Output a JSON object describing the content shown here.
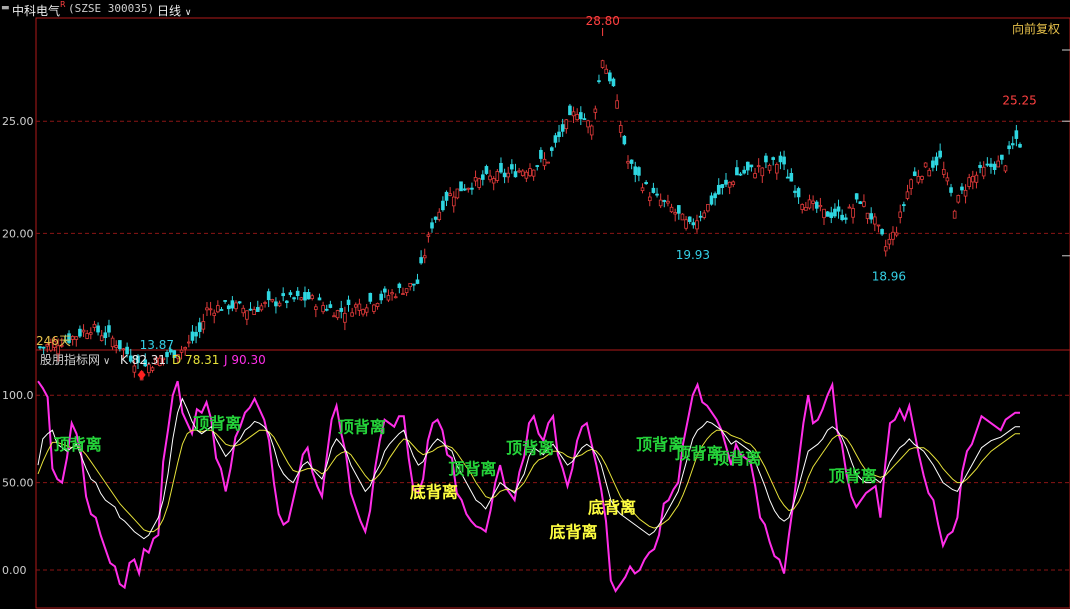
{
  "header": {
    "stock_name": "中科电气",
    "badge": "R",
    "code": "(SZSE 300035)",
    "period": "日线",
    "adjust": "向前复权"
  },
  "indicator": {
    "name": "股朋指标网",
    "k_label": "K 82.31",
    "d_label": "D 78.31",
    "j_label": "J 90.30"
  },
  "colors": {
    "background": "#000000",
    "frame": "#b01a1a",
    "grid": "#8a1515",
    "up": "#e03a3a",
    "down": "#2fd6e0",
    "k_line": "#ffffff",
    "d_line": "#e6e23a",
    "j_line": "#ff2ee8",
    "label_top": "#25d43a",
    "label_bottom": "#ffff40",
    "marker": "#ff2020"
  },
  "chart_data": [
    {
      "type": "candlestick",
      "panel": "price",
      "y_ticks": [
        "25.00",
        "20.00"
      ],
      "ylim": [
        14.8,
        29.6
      ],
      "days_label": "246天",
      "high_annotation": {
        "label": "28.80",
        "index": 155,
        "value": 28.8
      },
      "low_annotation": {
        "label": "13.87",
        "index": 28,
        "value": 13.87
      },
      "point_annotations": [
        {
          "label": "19.93",
          "index": 179,
          "value": 19.93
        },
        {
          "label": "18.96",
          "index": 233,
          "value": 18.96
        },
        {
          "label": "25.25",
          "index": 269,
          "value": 25.25
        }
      ],
      "close_anchors": [
        [
          0,
          14.9
        ],
        [
          8,
          15.3
        ],
        [
          14,
          15.8
        ],
        [
          20,
          15.3
        ],
        [
          28,
          14.0
        ],
        [
          32,
          14.3
        ],
        [
          40,
          14.9
        ],
        [
          44,
          15.6
        ],
        [
          46,
          16.6
        ],
        [
          52,
          16.8
        ],
        [
          58,
          16.6
        ],
        [
          66,
          17.0
        ],
        [
          74,
          17.1
        ],
        [
          82,
          16.5
        ],
        [
          90,
          16.9
        ],
        [
          97,
          17.3
        ],
        [
          104,
          17.8
        ],
        [
          108,
          20.4
        ],
        [
          112,
          21.6
        ],
        [
          116,
          22.0
        ],
        [
          122,
          22.4
        ],
        [
          128,
          22.6
        ],
        [
          134,
          22.9
        ],
        [
          140,
          23.3
        ],
        [
          144,
          24.6
        ],
        [
          148,
          25.5
        ],
        [
          152,
          24.7
        ],
        [
          155,
          27.8
        ],
        [
          158,
          26.5
        ],
        [
          162,
          23.2
        ],
        [
          168,
          21.8
        ],
        [
          174,
          21.1
        ],
        [
          179,
          20.3
        ],
        [
          186,
          21.6
        ],
        [
          192,
          22.6
        ],
        [
          198,
          22.9
        ],
        [
          204,
          23.2
        ],
        [
          210,
          21.5
        ],
        [
          216,
          20.9
        ],
        [
          222,
          20.8
        ],
        [
          226,
          21.5
        ],
        [
          230,
          20.5
        ],
        [
          233,
          19.4
        ],
        [
          236,
          20.2
        ],
        [
          240,
          22.4
        ],
        [
          244,
          22.9
        ],
        [
          248,
          23.3
        ],
        [
          252,
          21.2
        ],
        [
          256,
          22.4
        ],
        [
          262,
          23.0
        ],
        [
          266,
          23.2
        ],
        [
          269,
          24.2
        ],
        [
          270,
          24.0
        ]
      ]
    },
    {
      "type": "line",
      "panel": "KDJ",
      "y_ticks": [
        "100.0",
        "50.00",
        "0.00"
      ],
      "ylim": [
        -20,
        115
      ],
      "series": [
        {
          "name": "K",
          "values": [
            60,
            75,
            78,
            80,
            72,
            70,
            68,
            70,
            72,
            65,
            58,
            52,
            50,
            44,
            40,
            38,
            36,
            30,
            28,
            25,
            22,
            20,
            18,
            20,
            25,
            30,
            40,
            55,
            75,
            90,
            98,
            92,
            85,
            80,
            78,
            80,
            82,
            75,
            70,
            65,
            68,
            72,
            75,
            80,
            82,
            85,
            84,
            82,
            78,
            70,
            60,
            55,
            52,
            50,
            55,
            60,
            62,
            58,
            55,
            52,
            60,
            70,
            75,
            72,
            68,
            60,
            55,
            50,
            45,
            48,
            55,
            60,
            68,
            72,
            75,
            78,
            80,
            72,
            65,
            60,
            62,
            68,
            72,
            75,
            73,
            70,
            68,
            60,
            55,
            50,
            45,
            40,
            38,
            35,
            40,
            45,
            50,
            48,
            46,
            44,
            50,
            55,
            65,
            70,
            68,
            66,
            70,
            72,
            68,
            64,
            60,
            62,
            66,
            70,
            72,
            70,
            66,
            60,
            50,
            40,
            35,
            32,
            30,
            28,
            26,
            24,
            22,
            20,
            22,
            26,
            30,
            35,
            40,
            45,
            55,
            65,
            75,
            80,
            82,
            85,
            84,
            82,
            80,
            76,
            72,
            74,
            72,
            70,
            68,
            62,
            55,
            48,
            40,
            34,
            30,
            28,
            30,
            38,
            48,
            58,
            68,
            70,
            72,
            75,
            80,
            82,
            80,
            76,
            70,
            62,
            55,
            52,
            50,
            50,
            52,
            50,
            55,
            62,
            66,
            70,
            72,
            75,
            72,
            70,
            68,
            64,
            60,
            55,
            50,
            48,
            46,
            45,
            50,
            55,
            60,
            65,
            70,
            72,
            74,
            75,
            76,
            78,
            80,
            82,
            82
          ]
        },
        {
          "name": "D",
          "values": [
            55,
            62,
            68,
            73,
            73,
            72,
            71,
            70,
            71,
            69,
            66,
            62,
            58,
            54,
            50,
            46,
            42,
            38,
            35,
            32,
            29,
            26,
            23,
            22,
            22,
            24,
            29,
            37,
            49,
            61,
            72,
            78,
            80,
            80,
            79,
            80,
            80,
            78,
            75,
            72,
            71,
            71,
            72,
            74,
            76,
            78,
            80,
            80,
            79,
            76,
            71,
            66,
            61,
            57,
            56,
            57,
            58,
            58,
            57,
            55,
            57,
            61,
            65,
            67,
            68,
            66,
            62,
            58,
            54,
            51,
            52,
            55,
            59,
            64,
            68,
            72,
            75,
            74,
            71,
            68,
            66,
            67,
            68,
            70,
            71,
            71,
            70,
            67,
            63,
            59,
            55,
            50,
            46,
            42,
            41,
            42,
            45,
            46,
            46,
            45,
            47,
            50,
            55,
            60,
            63,
            64,
            66,
            68,
            68,
            67,
            65,
            64,
            65,
            66,
            68,
            69,
            68,
            65,
            60,
            54,
            48,
            42,
            38,
            35,
            32,
            29,
            27,
            25,
            24,
            25,
            27,
            29,
            33,
            37,
            43,
            50,
            58,
            66,
            71,
            75,
            78,
            80,
            80,
            79,
            77,
            76,
            75,
            73,
            72,
            69,
            64,
            59,
            53,
            47,
            41,
            37,
            34,
            35,
            39,
            45,
            53,
            59,
            63,
            67,
            71,
            75,
            77,
            77,
            75,
            71,
            66,
            61,
            57,
            55,
            54,
            53,
            54,
            57,
            60,
            63,
            66,
            69,
            70,
            70,
            70,
            68,
            65,
            62,
            58,
            55,
            52,
            50,
            50,
            52,
            55,
            58,
            62,
            65,
            68,
            70,
            72,
            74,
            76,
            78,
            78
          ]
        },
        {
          "name": "J",
          "values": [
            108,
            104,
            99,
            58,
            52,
            50,
            64,
            84,
            78,
            66,
            42,
            32,
            30,
            20,
            12,
            4,
            2,
            -8,
            -10,
            4,
            6,
            -2,
            12,
            10,
            18,
            20,
            62,
            80,
            100,
            108,
            90,
            84,
            78,
            92,
            90,
            96,
            86,
            64,
            58,
            45,
            58,
            76,
            82,
            90,
            93,
            98,
            92,
            86,
            74,
            50,
            32,
            26,
            28,
            40,
            52,
            66,
            70,
            56,
            48,
            42,
            65,
            86,
            94,
            78,
            66,
            44,
            36,
            28,
            22,
            34,
            58,
            74,
            86,
            84,
            82,
            88,
            88,
            64,
            46,
            44,
            52,
            74,
            84,
            86,
            80,
            66,
            64,
            44,
            40,
            32,
            28,
            25,
            24,
            22,
            34,
            50,
            60,
            48,
            44,
            40,
            56,
            65,
            84,
            88,
            78,
            74,
            84,
            88,
            66,
            58,
            48,
            58,
            74,
            82,
            84,
            72,
            60,
            46,
            28,
            -6,
            -12,
            -8,
            -4,
            2,
            -2,
            0,
            6,
            10,
            12,
            20,
            38,
            40,
            46,
            50,
            72,
            86,
            100,
            106,
            96,
            94,
            90,
            86,
            80,
            70,
            60,
            72,
            66,
            64,
            62,
            48,
            30,
            26,
            16,
            8,
            6,
            -2,
            20,
            40,
            62,
            84,
            100,
            84,
            86,
            92,
            100,
            106,
            80,
            72,
            54,
            42,
            36,
            40,
            44,
            46,
            48,
            30,
            60,
            84,
            86,
            92,
            86,
            94,
            80,
            66,
            54,
            44,
            40,
            26,
            14,
            20,
            22,
            30,
            56,
            68,
            72,
            80,
            88,
            86,
            84,
            82,
            80,
            86,
            88,
            90,
            90
          ]
        }
      ],
      "labels": [
        {
          "text": "顶背离",
          "kind": "top",
          "index": 7,
          "value": 72
        },
        {
          "text": "顶背离",
          "kind": "top",
          "index": 36,
          "value": 84
        },
        {
          "text": "顶背离",
          "kind": "top",
          "index": 66,
          "value": 82
        },
        {
          "text": "底背离",
          "kind": "bottom",
          "index": 81,
          "value": 45
        },
        {
          "text": "顶背离",
          "kind": "top",
          "index": 89,
          "value": 58
        },
        {
          "text": "顶背离",
          "kind": "top",
          "index": 101,
          "value": 70
        },
        {
          "text": "底背离",
          "kind": "bottom",
          "index": 110,
          "value": 22
        },
        {
          "text": "底背离",
          "kind": "bottom",
          "index": 118,
          "value": 36
        },
        {
          "text": "顶背离",
          "kind": "top",
          "index": 128,
          "value": 72
        },
        {
          "text": "顶背离",
          "kind": "top",
          "index": 136,
          "value": 67
        },
        {
          "text": "顶背离",
          "kind": "top",
          "index": 144,
          "value": 64
        },
        {
          "text": "顶背离",
          "kind": "top",
          "index": 168,
          "value": 54
        }
      ]
    }
  ]
}
